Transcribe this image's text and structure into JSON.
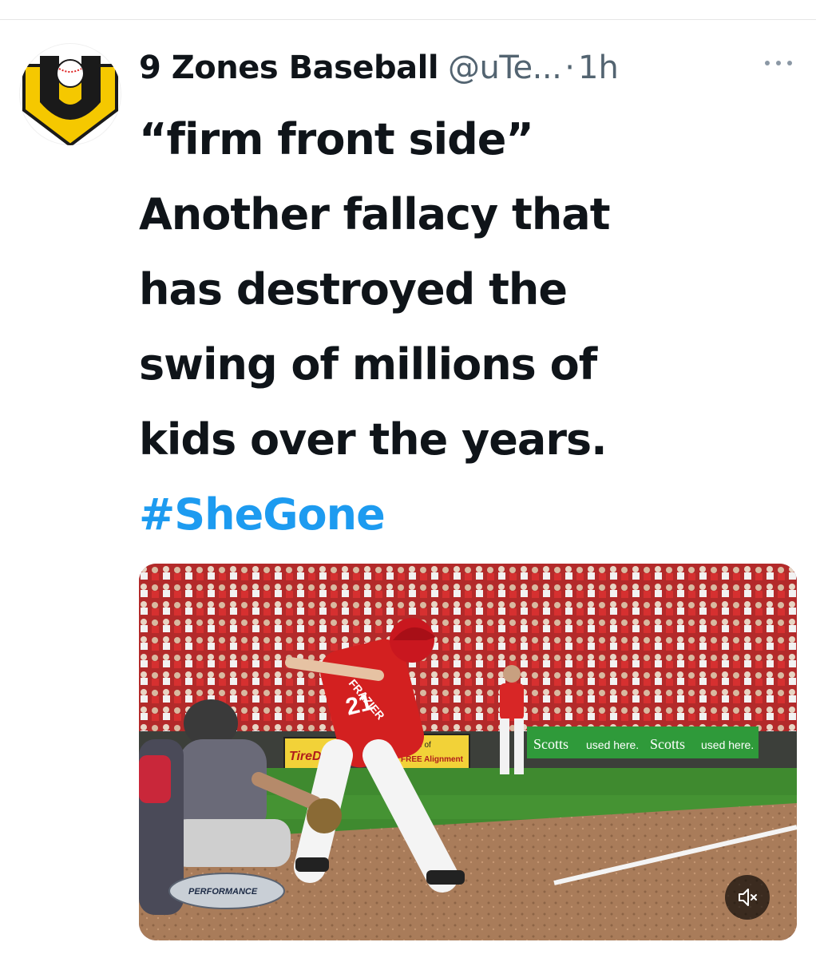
{
  "tweet": {
    "author_name": "9 Zones Baseball",
    "author_handle": "@uTe...",
    "separator": "·",
    "time": "1h",
    "text_lines": [
      "“firm front side”",
      "Another fallacy that",
      "has destroyed the",
      "swing of millions of",
      "kids over the years."
    ],
    "hashtag": "#SheGone"
  },
  "media": {
    "type": "video",
    "player_jersey_name": "FRAZIER",
    "player_number": "21",
    "ad_signs": {
      "left": "TireDisco",
      "middle_top": "Home of",
      "middle_bottom": "FREE Alignment",
      "scotts_1": "Scotts",
      "scotts_1_tag": "used here.",
      "scotts_2": "Scotts",
      "scotts_2_tag": "used here."
    },
    "broadcast_logo": "PERFORMANCE"
  },
  "icons": {
    "avatar": "u-logo-baseball-icon",
    "more": "more-options-icon",
    "mute": "volume-muted-icon"
  },
  "colors": {
    "link_blue": "#1d9bf0",
    "logo_yellow": "#f5c800",
    "secondary_text": "#536471"
  }
}
